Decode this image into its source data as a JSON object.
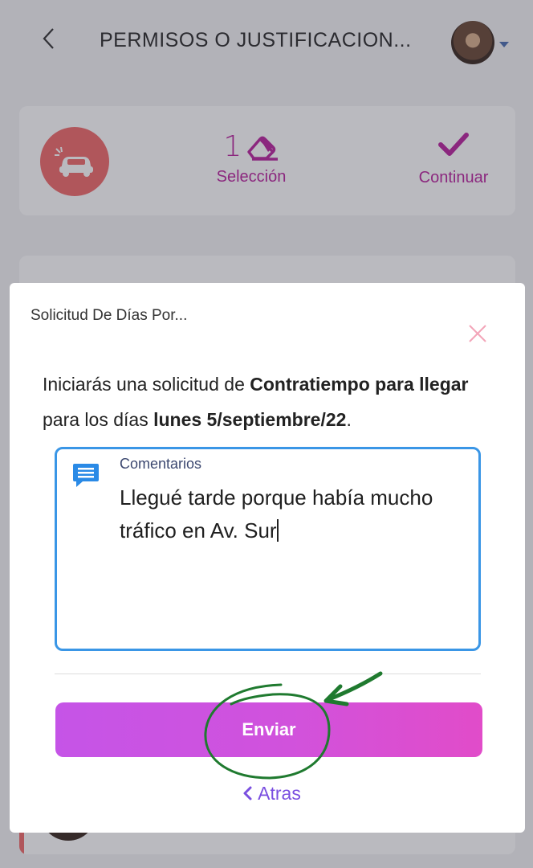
{
  "header": {
    "title": "PERMISOS O JUSTIFICACION..."
  },
  "summary": {
    "selection_count": "1",
    "selection_label": "Selección",
    "continue_label": "Continuar"
  },
  "modal": {
    "title": "Solicitud De Días Por...",
    "message_intro": "Iniciarás una solicitud de ",
    "message_type": "Contratiempo para llegar",
    "message_mid": " para los días ",
    "message_date": "lunes 5/septiembre/22",
    "message_end": ".",
    "comment_label": "Comentarios",
    "comment_value": "Llegué tarde porque había mucho tráfico en Av. Sur",
    "send_label": "Enviar",
    "back_label": "Atras"
  },
  "colors": {
    "accent": "#b9259f",
    "button_start": "#c554e7",
    "button_end": "#e14cc9",
    "input_border": "#3a96e6",
    "link": "#7a4fe0",
    "badge": "#f06a6a",
    "annotation": "#1f7a2f"
  }
}
